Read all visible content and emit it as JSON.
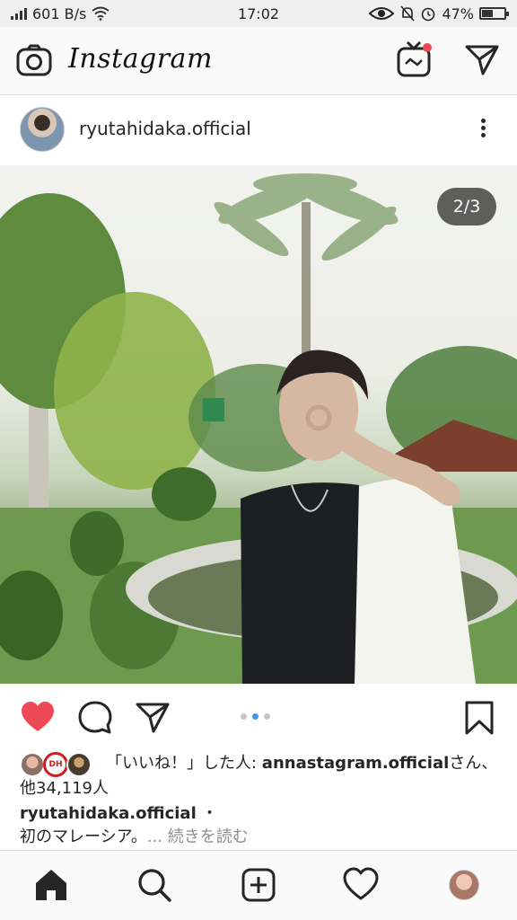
{
  "status_bar": {
    "network_speed": "601 B/s",
    "time": "17:02",
    "battery_percent": "47%",
    "battery_level": 0.47
  },
  "header": {
    "logo_text": "Instagram",
    "icons": [
      "camera-icon",
      "igtv-icon",
      "direct-message-icon"
    ],
    "igtv_notification_color": "#ed4956"
  },
  "post": {
    "username": "ryutahidaka.official",
    "image_counter": "2/3",
    "current_image": 2,
    "total_images": 3
  },
  "actions": {
    "liked": true,
    "like_color": "#ed4956",
    "active_dot_color": "#3897f0",
    "icons": [
      "heart-icon",
      "comment-icon",
      "share-icon",
      "bookmark-icon"
    ]
  },
  "likes": {
    "prefix": "「いいね！」した人: ",
    "liker": "annastagram.official",
    "suffix": "さん、他34,119人",
    "avatar_badge": "DH"
  },
  "caption": {
    "username": "ryutahidaka.official",
    "separator": " ・",
    "text": "初のマレーシア。",
    "more": "... 続きを読む"
  },
  "bottom_nav": {
    "icons": [
      "home-icon",
      "search-icon",
      "add-post-icon",
      "activity-heart-icon",
      "profile-avatar"
    ]
  }
}
